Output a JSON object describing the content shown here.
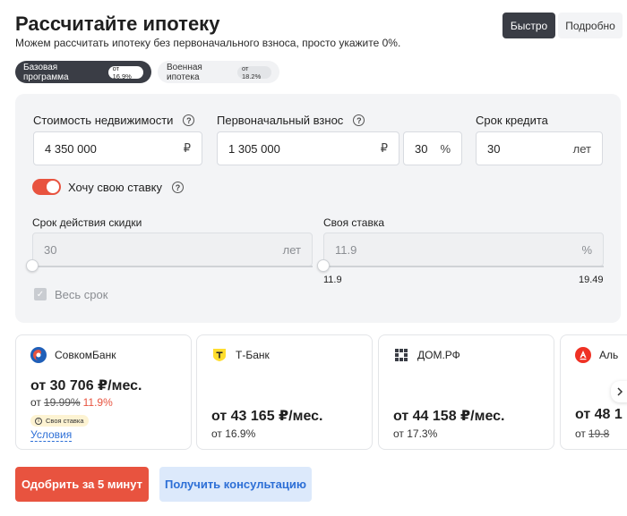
{
  "header": {
    "title": "Рассчитайте ипотеку",
    "subtitle": "Можем рассчитать ипотеку без первоначального взноса, просто укажите 0%."
  },
  "mode": {
    "fast": "Быстро",
    "detailed": "Подробно",
    "selected": "Быстро"
  },
  "programs": [
    {
      "label": "Базовая программа",
      "badge": "от 16.9%",
      "active": true
    },
    {
      "label": "Военная ипотека",
      "badge": "от 18.2%",
      "active": false
    }
  ],
  "calculator": {
    "property_value": {
      "label": "Стоимость недвижимости",
      "value": "4 350 000",
      "suffix": "₽"
    },
    "down_payment": {
      "label": "Первоначальный взнос",
      "value": "1 305 000",
      "suffix": "₽",
      "percent": "30",
      "percent_suffix": "%"
    },
    "term": {
      "label": "Срок кредита",
      "value": "30",
      "suffix": "лет"
    },
    "own_rate_toggle": {
      "label": "Хочу свою ставку",
      "on": true
    },
    "discount_term": {
      "label": "Срок действия скидки",
      "value": "30",
      "suffix": "лет"
    },
    "own_rate": {
      "label": "Своя ставка",
      "value": "11.9",
      "suffix": "%",
      "min": "11.9",
      "max": "19.49"
    },
    "whole_term": {
      "label": "Весь срок",
      "checked": true
    }
  },
  "offers": [
    {
      "bank": "СовкомБанк",
      "payment": "от 30 706 ₽/мес.",
      "rate_prefix": "от",
      "old_rate": "19.99%",
      "new_rate": "11.9%",
      "badge": "Своя ставка",
      "link": "Условия",
      "logo_color": "#1f5fb8",
      "logo_accent": "#e8533f"
    },
    {
      "bank": "Т-Банк",
      "payment": "от 43 165 ₽/мес.",
      "rate": "от 16.9%",
      "logo_color": "#ffdd2d"
    },
    {
      "bank": "ДОМ.РФ",
      "payment": "от 44 158 ₽/мес.",
      "rate": "от 17.3%",
      "logo_color": "#3a3d45"
    },
    {
      "bank": "Аль",
      "payment": "от 48 1",
      "rate_prefix": "от",
      "old_rate": "19.8",
      "logo_color": "#ef3124"
    }
  ],
  "actions": {
    "approve": "Одобрить за 5 минут",
    "consult": "Получить консультацию"
  },
  "colors": {
    "accent": "#e8533f",
    "dark": "#3a3d45",
    "link": "#2d6fd6"
  }
}
